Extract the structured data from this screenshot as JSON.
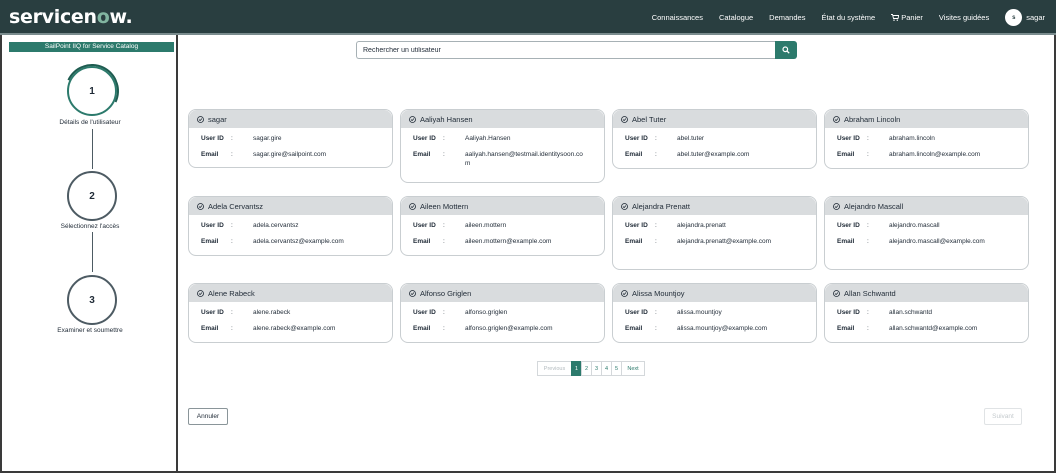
{
  "brand": {
    "logo_pre": "servicen",
    "logo_o": "o",
    "logo_post": "w.",
    "accent": "#2c7a6c",
    "topbar_bg": "#293e40"
  },
  "topnav": {
    "items": [
      "Connaissances",
      "Catalogue",
      "Demandes",
      "État du système"
    ],
    "cart_label": "Panier",
    "tours_label": "Visites guidées",
    "avatar_initial": "s",
    "username": "sagar"
  },
  "sidebar": {
    "title": "SailPoint IIQ for Service Catalog",
    "steps": [
      {
        "number": "1",
        "label": "Détails de l'utilisateur"
      },
      {
        "number": "2",
        "label": "Sélectionnez l'accès"
      },
      {
        "number": "3",
        "label": "Examiner et soumettre"
      }
    ]
  },
  "search": {
    "placeholder": "Rechercher un utilisateur",
    "icon": "search-icon"
  },
  "field_labels": {
    "user_id": "User ID",
    "email": "Email",
    "sep": ":"
  },
  "users": [
    {
      "name": "sagar",
      "user_id": "sagar.gire",
      "email": "sagar.gire@sailpoint.com"
    },
    {
      "name": "Aaliyah Hansen",
      "user_id": "Aaliyah.Hansen",
      "email": "aaliyah.hansen@testmail.identitysoon.com"
    },
    {
      "name": "Abel Tuter",
      "user_id": "abel.tuter",
      "email": "abel.tuter@example.com"
    },
    {
      "name": "Abraham Lincoln",
      "user_id": "abraham.lincoln",
      "email": "abraham.lincoln@example.com"
    },
    {
      "name": "Adela Cervantsz",
      "user_id": "adela.cervantsz",
      "email": "adela.cervantsz@example.com"
    },
    {
      "name": "Aileen Mottern",
      "user_id": "aileen.mottern",
      "email": "aileen.mottern@example.com"
    },
    {
      "name": "Alejandra Prenatt",
      "user_id": "alejandra.prenatt",
      "email": "alejandra.prenatt@example.com"
    },
    {
      "name": "Alejandro Mascall",
      "user_id": "alejandro.mascall",
      "email": "alejandro.mascall@example.com"
    },
    {
      "name": "Alene Rabeck",
      "user_id": "alene.rabeck",
      "email": "alene.rabeck@example.com"
    },
    {
      "name": "Alfonso Griglen",
      "user_id": "alfonso.griglen",
      "email": "alfonso.griglen@example.com"
    },
    {
      "name": "Alissa Mountjoy",
      "user_id": "alissa.mountjoy",
      "email": "alissa.mountjoy@example.com"
    },
    {
      "name": "Allan Schwantd",
      "user_id": "allan.schwantd",
      "email": "allan.schwantd@example.com"
    }
  ],
  "pagination": {
    "previous": "Previous",
    "pages": [
      "1",
      "2",
      "3",
      "4",
      "5"
    ],
    "current": "1",
    "next": "Next"
  },
  "actions": {
    "cancel": "Annuler",
    "next": "Suivant"
  }
}
